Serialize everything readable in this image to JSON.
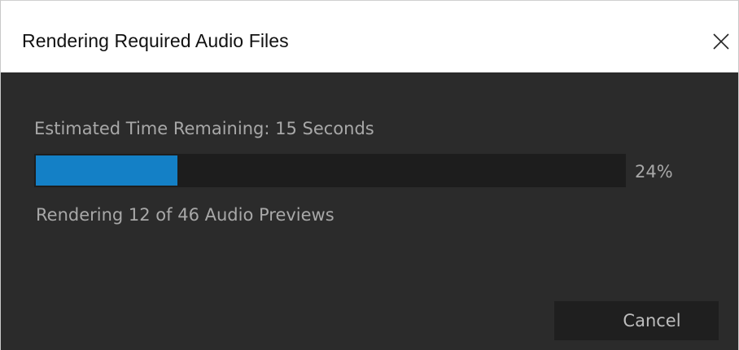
{
  "window": {
    "title": "Rendering Required Audio Files",
    "close_icon": "close-icon"
  },
  "progress": {
    "time_remaining": "Estimated Time Remaining: 15 Seconds",
    "percent_label": "24%",
    "fraction": 0.24,
    "fill_color": "#1480c6",
    "status": "Rendering 12 of 46 Audio Previews"
  },
  "actions": {
    "cancel_label": "Cancel"
  }
}
